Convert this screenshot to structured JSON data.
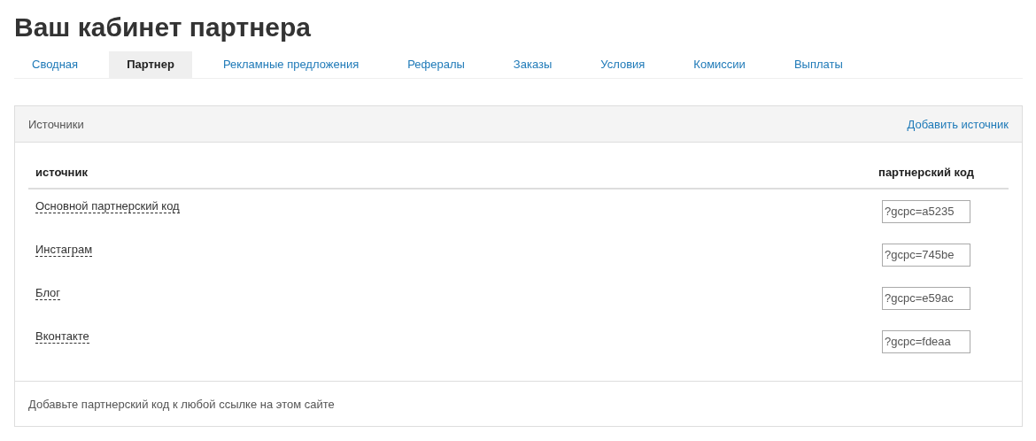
{
  "title": "Ваш кабинет партнера",
  "tabs": [
    {
      "label": "Сводная",
      "selected": false
    },
    {
      "label": "Партнер",
      "selected": true
    },
    {
      "label": "Рекламные предложения",
      "selected": false
    },
    {
      "label": "Рефералы",
      "selected": false
    },
    {
      "label": "Заказы",
      "selected": false
    },
    {
      "label": "Условия",
      "selected": false
    },
    {
      "label": "Комиссии",
      "selected": false
    },
    {
      "label": "Выплаты",
      "selected": false
    }
  ],
  "panel": {
    "title": "Источники",
    "add_link": "Добавить источник",
    "table": {
      "columns": [
        "источник",
        "партнерский код"
      ],
      "rows": [
        {
          "source": "Основной партнерский код",
          "code": "?gcpc=a5235"
        },
        {
          "source": "Инстаграм",
          "code": "?gcpc=745be"
        },
        {
          "source": "Блог",
          "code": "?gcpc=e59ac"
        },
        {
          "source": "Вконтакте",
          "code": "?gcpc=fdeaa"
        }
      ]
    },
    "footer": "Добавьте партнерский код к любой ссылке на этом сайте"
  }
}
